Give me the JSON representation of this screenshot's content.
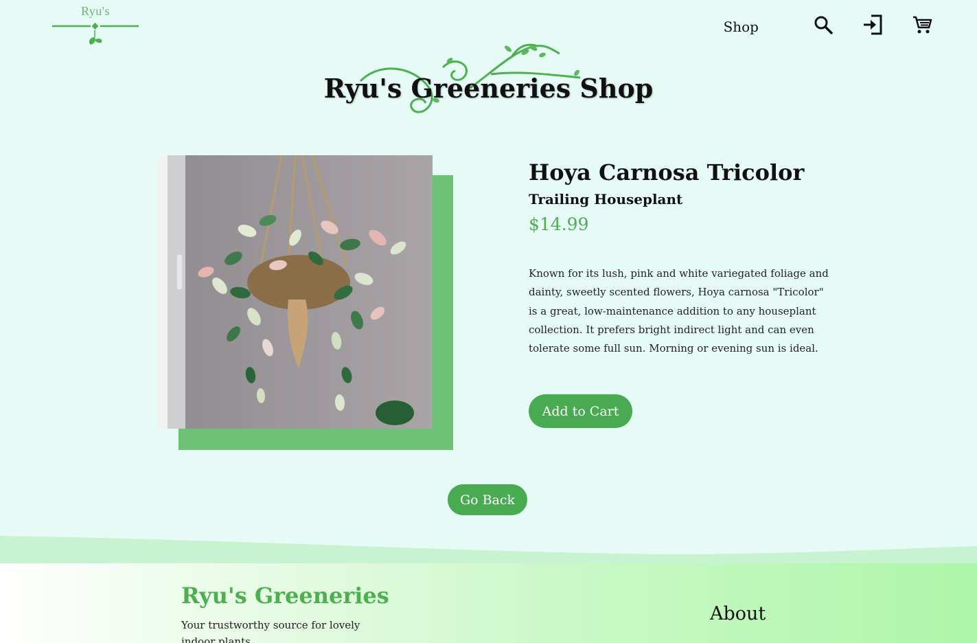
{
  "header": {
    "logo_text": "Ryu's",
    "nav_shop": "Shop",
    "icons": [
      "search-icon",
      "login-icon",
      "cart-icon"
    ]
  },
  "hero": {
    "title": "Ryu's Greeneries Shop"
  },
  "product": {
    "name": "Hoya Carnosa Tricolor",
    "subtitle": "Trailing Houseplant",
    "price": "$14.99",
    "description": "Known for its lush, pink and white variegated foliage and dainty, sweetly scented flowers, Hoya carnosa \"Tricolor\" is a great, low-maintenance addition to any houseplant collection. It prefers bright indirect light and can even tolerate some full sun. Morning or evening sun is ideal.",
    "add_to_cart": "Add to Cart"
  },
  "go_back": "Go Back",
  "footer": {
    "brand": "Ryu's Greeneries",
    "tagline": "Your trustworthy source for lovely indoor plants",
    "about": "About"
  },
  "colors": {
    "background": "#e6fbf5",
    "accent": "#4caf50",
    "button": "#49ab51",
    "image_shadow": "#6cc172"
  }
}
